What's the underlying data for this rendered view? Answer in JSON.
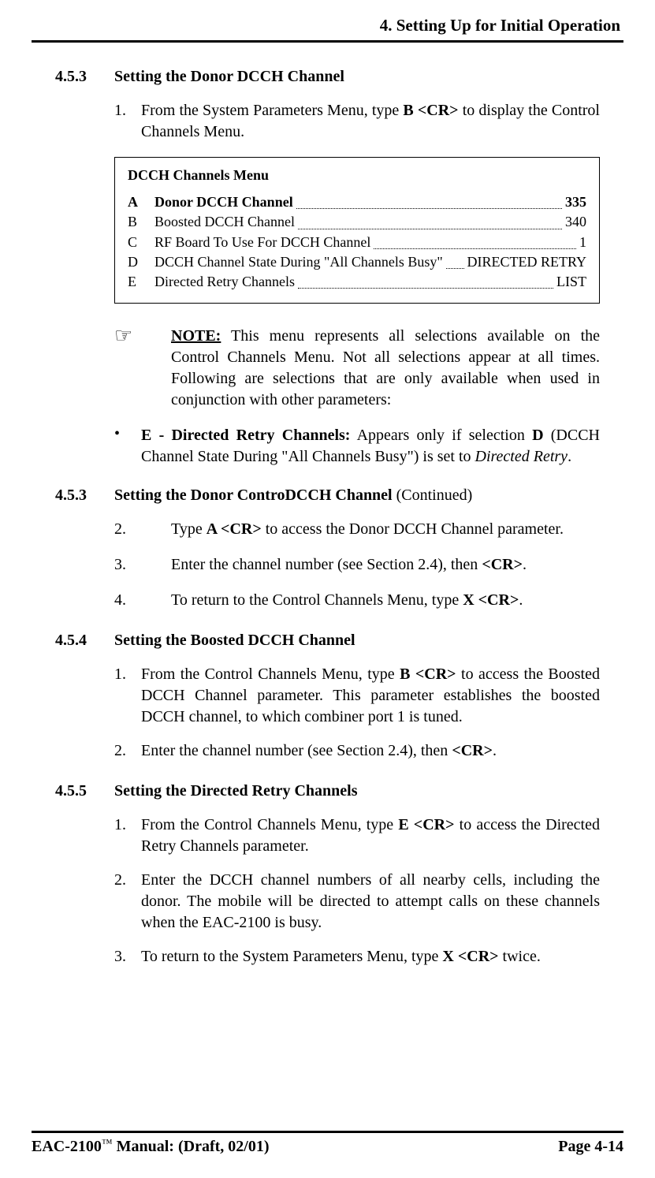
{
  "header": "4. Setting Up for Initial Operation",
  "s453a": {
    "num": "4.5.3",
    "title": "Setting the Donor DCCH Channel",
    "step1_num": "1.",
    "step1_pre": "From the System Parameters Menu, type ",
    "step1_cmd": "B <CR>",
    "step1_post": " to display the Control Channels Menu."
  },
  "menu": {
    "title": "DCCH Channels Menu",
    "rows": [
      {
        "key": "A",
        "label": "Donor DCCH Channel",
        "value": " 335",
        "bold": true
      },
      {
        "key": "B",
        "label": "Boosted DCCH Channel",
        "value": " 340",
        "bold": false
      },
      {
        "key": "C",
        "label": "RF Board To Use For DCCH Channel",
        "value": "1",
        "bold": false
      },
      {
        "key": "D",
        "label": "DCCH Channel State During \"All Channels Busy\"",
        "value": "DIRECTED RETRY",
        "bold": false
      },
      {
        "key": "E",
        "label": "Directed Retry Channels",
        "value": "LIST",
        "bold": false
      }
    ]
  },
  "note": {
    "lead": "NOTE:",
    "text": " This menu represents all selections available on the Control Channels Menu. Not all selections appear at all times. Following are selections that are only available when used in conjunction with other parameters:"
  },
  "bullet": {
    "lead": "E - Directed Retry Channels:",
    "mid": " Appears only if selection ",
    "d": "D",
    "mid2": " (DCCH Channel State During \"All Channels Busy\") is set to ",
    "ital": "Directed Retry",
    "end": "."
  },
  "s453b": {
    "num": "4.5.3",
    "title": "Setting the Donor ControDCCH Channel ",
    "cont": "(Continued)",
    "step2_num": "2.",
    "step2_pre": "Type ",
    "step2_cmd": "A <CR>",
    "step2_post": " to access the Donor DCCH Channel parameter.",
    "step3_num": "3.",
    "step3_pre": "Enter the channel number (see Section 2.4), then ",
    "step3_cmd": "<CR>",
    "step3_post": ".",
    "step4_num": "4.",
    "step4_pre": "To return to the Control Channels Menu, type ",
    "step4_cmd": "X <CR>",
    "step4_post": "."
  },
  "s454": {
    "num": "4.5.4",
    "title": "Setting the Boosted DCCH Channel",
    "step1_num": "1.",
    "step1_pre": "From the Control Channels Menu, type ",
    "step1_cmd": "B <CR>",
    "step1_post": " to access the Boosted DCCH Channel parameter. This parameter establishes the boosted DCCH channel, to which combiner port 1 is tuned.",
    "step2_num": "2.",
    "step2_pre": "Enter the channel number (see Section 2.4), then ",
    "step2_cmd": "<CR>",
    "step2_post": "."
  },
  "s455": {
    "num": "4.5.5",
    "title": "Setting the Directed Retry Channels",
    "step1_num": "1.",
    "step1_pre": "From the Control Channels Menu, type ",
    "step1_cmd": "E <CR>",
    "step1_post": " to access the Directed Retry Channels parameter.",
    "step2_num": "2.",
    "step2_text": "Enter the DCCH channel numbers of all nearby cells, including the donor. The mobile will be directed to attempt calls on these channels when the EAC-2100 is busy.",
    "step3_num": "3.",
    "step3_pre": "To return to the System Parameters Menu, type ",
    "step3_cmd": "X <CR>",
    "step3_post": " twice."
  },
  "footer": {
    "left_pre": "EAC-2100",
    "left_tm": "™",
    "left_post": " Manual: (Draft, 02/01)",
    "right": "Page 4-14"
  }
}
